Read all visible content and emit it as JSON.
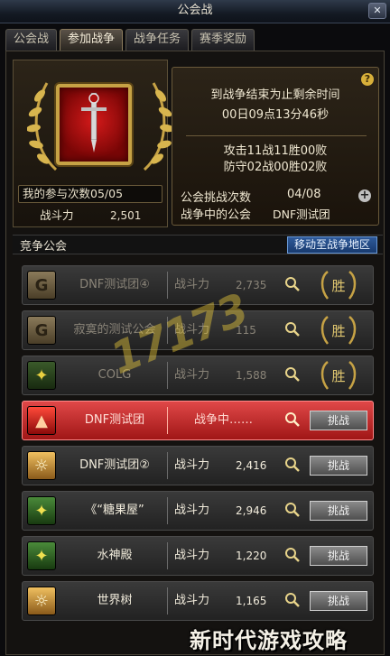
{
  "window": {
    "title": "公会战",
    "close_label": "✕"
  },
  "tabs": [
    {
      "label": "公会战",
      "active": false
    },
    {
      "label": "参加战争",
      "active": true
    },
    {
      "label": "战争任务",
      "active": false
    },
    {
      "label": "赛季奖励",
      "active": false
    }
  ],
  "player": {
    "participation": "我的参与次数05/05",
    "power_label": "战斗力",
    "power_value": "2,501"
  },
  "war_info": {
    "help_label": "?",
    "countdown_title": "到战争结束为止剩余时间",
    "countdown_value": "00日09点13分46秒",
    "attack_record": "攻击11战11胜00败",
    "defense_record": "防守02战00胜02败",
    "challenge_label": "公会挑战次数",
    "challenge_value": "04/08",
    "at_war_label": "战争中的公会",
    "at_war_value": "DNF测试团",
    "plus_label": "+"
  },
  "section": {
    "title": "竞争公会",
    "move_button": "移动至战争地区"
  },
  "guilds": [
    {
      "name": "DNF测试团④",
      "power_label": "战斗力",
      "power": "2,735",
      "state": "won",
      "badge": "胜",
      "icon": "G",
      "icon_color": "#7a6a4a"
    },
    {
      "name": "寂寞的测试公会",
      "power_label": "战斗力",
      "power": "115",
      "state": "won",
      "badge": "胜",
      "icon": "G",
      "icon_color": "#7a6a4a"
    },
    {
      "name": "COLG",
      "power_label": "战斗力",
      "power": "1,588",
      "state": "won",
      "badge": "胜",
      "icon": "eagle",
      "icon_color": "#3a6a2a"
    },
    {
      "name": "DNF测试团",
      "status": "战争中……",
      "state": "active",
      "button": "挑战",
      "icon": "flame",
      "icon_color": "#c02020"
    },
    {
      "name": "DNF测试团②",
      "power_label": "战斗力",
      "power": "2,416",
      "state": "open",
      "button": "挑战",
      "icon": "sun",
      "icon_color": "#c88a2a"
    },
    {
      "name": "《“糖果屋”",
      "power_label": "战斗力",
      "power": "2,946",
      "state": "open",
      "button": "挑战",
      "icon": "eagle",
      "icon_color": "#3a7a2a"
    },
    {
      "name": "水神殿",
      "power_label": "战斗力",
      "power": "1,220",
      "state": "open",
      "button": "挑战",
      "icon": "eagle",
      "icon_color": "#3a7a2a"
    },
    {
      "name": "世界树",
      "power_label": "战斗力",
      "power": "1,165",
      "state": "open",
      "button": "挑战",
      "icon": "sun",
      "icon_color": "#c88a2a"
    }
  ],
  "overlay": {
    "logo_text": "17173",
    "watermark": "新时代游戏攻略"
  },
  "colors": {
    "accent_gold": "#c6a245",
    "active_row": "#c02828",
    "move_button": "#2e5a9a"
  }
}
